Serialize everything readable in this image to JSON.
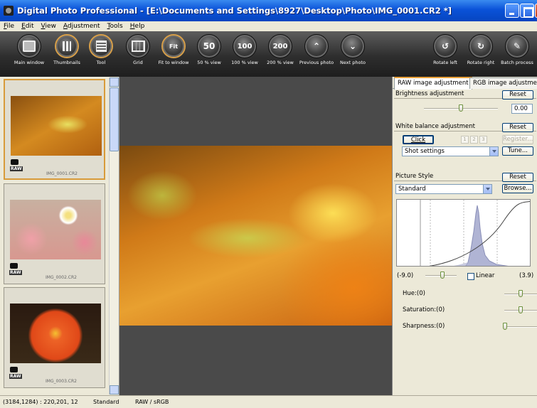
{
  "window": {
    "title": "Digital Photo Professional - [E:\\Documents and Settings\\8927\\Desktop\\Photo\\IMG_0001.CR2 *]"
  },
  "menu": [
    "File",
    "Edit",
    "View",
    "Adjustment",
    "Tools",
    "Help"
  ],
  "toolbar": {
    "main_window": "Main window",
    "thumbnails": "Thumbnails",
    "tool": "Tool",
    "grid": "Grid",
    "fit_to_window": "Fit to window",
    "fit_glyph": "Fit",
    "view50": "50 % view",
    "view50_glyph": "50",
    "view100": "100 % view",
    "view100_glyph": "100",
    "view200": "200 % view",
    "view200_glyph": "200",
    "previous_photo": "Previous photo",
    "next_photo": "Next photo",
    "rotate_left": "Rotate left",
    "rotate_right": "Rotate right",
    "batch_process": "Batch process"
  },
  "thumbnails": [
    {
      "badge": "RAW",
      "filename": "IMG_0001.CR2",
      "selected": true
    },
    {
      "badge": "RAW",
      "filename": "IMG_0002.CR2",
      "selected": false
    },
    {
      "badge": "RAW",
      "filename": "IMG_0003.CR2",
      "selected": false
    }
  ],
  "right": {
    "tab_raw": "RAW image adjustment",
    "tab_rgb": "RGB image adjustment",
    "brightness": {
      "title": "Brightness adjustment",
      "reset": "Reset",
      "value": "0.00"
    },
    "white_balance": {
      "title": "White balance adjustment",
      "reset": "Reset",
      "click": "Click",
      "num1": "1",
      "num2": "2",
      "num3": "3",
      "register": "Register...",
      "mode": "Shot settings",
      "tune": "Tune..."
    },
    "picture_style": {
      "title": "Picture Style",
      "reset": "Reset",
      "style": "Standard",
      "browse": "Browse...",
      "min": "(-9.0)",
      "linear": "Linear",
      "max": "(3.9)",
      "hue": "Hue:(0)",
      "saturation": "Saturation:(0)",
      "sharpness": "Sharpness:(0)"
    }
  },
  "status": {
    "coords": "(3184,1284) : 220,201, 12",
    "style": "Standard",
    "color": "RAW / sRGB"
  },
  "colors": {
    "title_bar": "#0a52d8",
    "toolbar": "#2e2e2e",
    "viewer_bg": "#4a4a4a",
    "accent": "#d89b3a"
  }
}
